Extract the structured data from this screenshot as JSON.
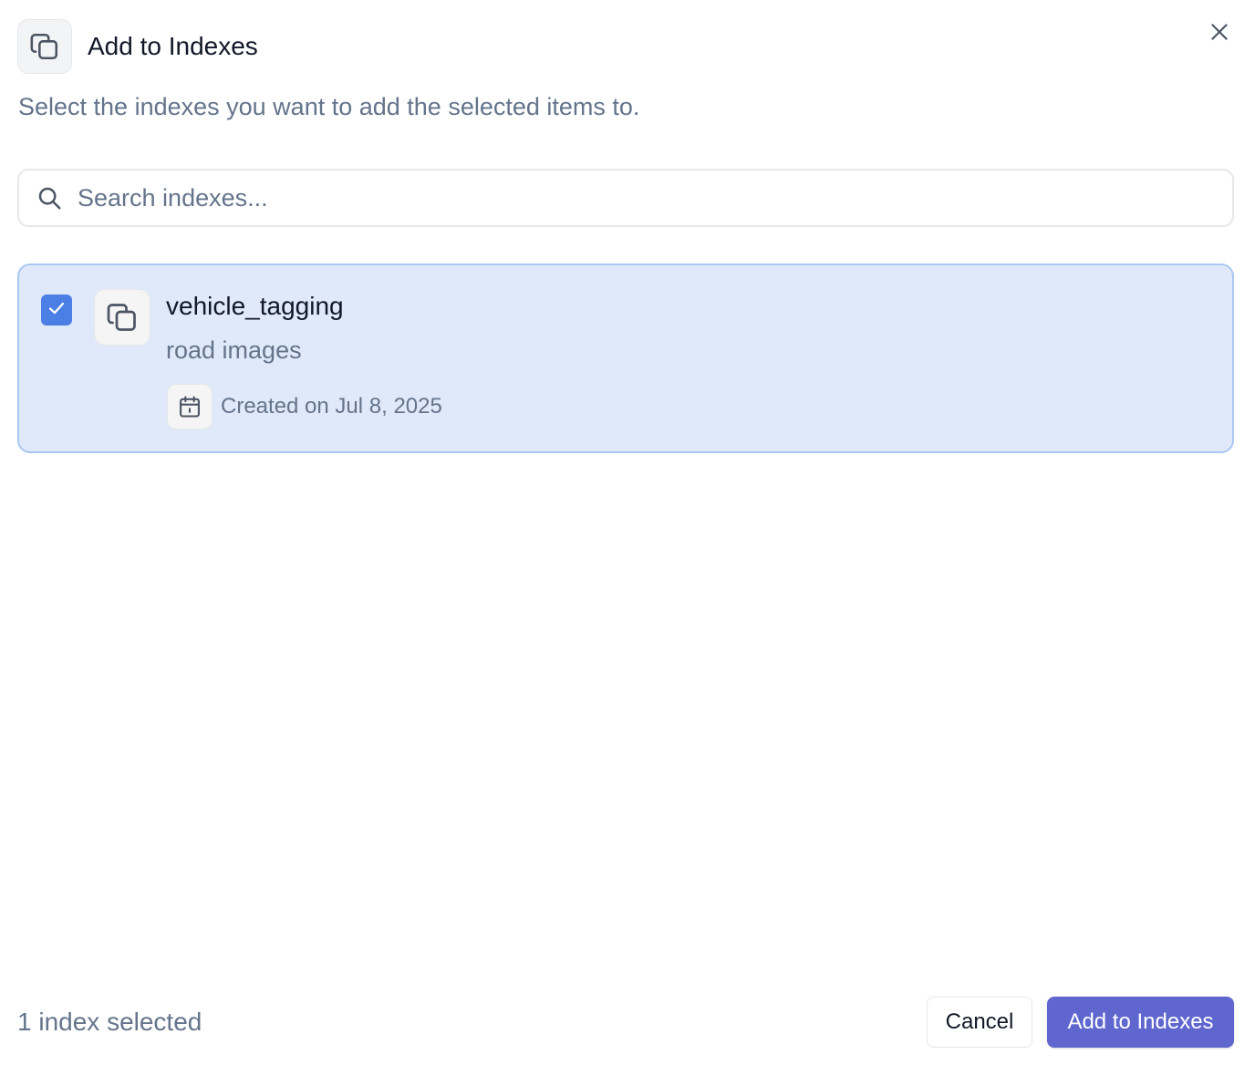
{
  "dialog": {
    "title": "Add to Indexes",
    "subtitle": "Select the indexes you want to add the selected items to.",
    "header_icon": "copy-stack-icon",
    "close_icon": "close-icon"
  },
  "search": {
    "placeholder": "Search indexes...",
    "value": "",
    "icon": "search-icon"
  },
  "indexes": [
    {
      "name": "vehicle_tagging",
      "description": "road images",
      "created": "Created on Jul 8, 2025",
      "checked": true,
      "icon": "copy-stack-icon",
      "date_icon": "calendar-icon"
    }
  ],
  "footer": {
    "selected_count": "1 index selected",
    "cancel_label": "Cancel",
    "submit_label": "Add to Indexes"
  },
  "colors": {
    "primary": "#5f67cf",
    "checkbox": "#4c7fe6",
    "selected_bg": "#dfe9fa",
    "selected_border": "#a9c7f2",
    "muted_text": "#64748b"
  }
}
